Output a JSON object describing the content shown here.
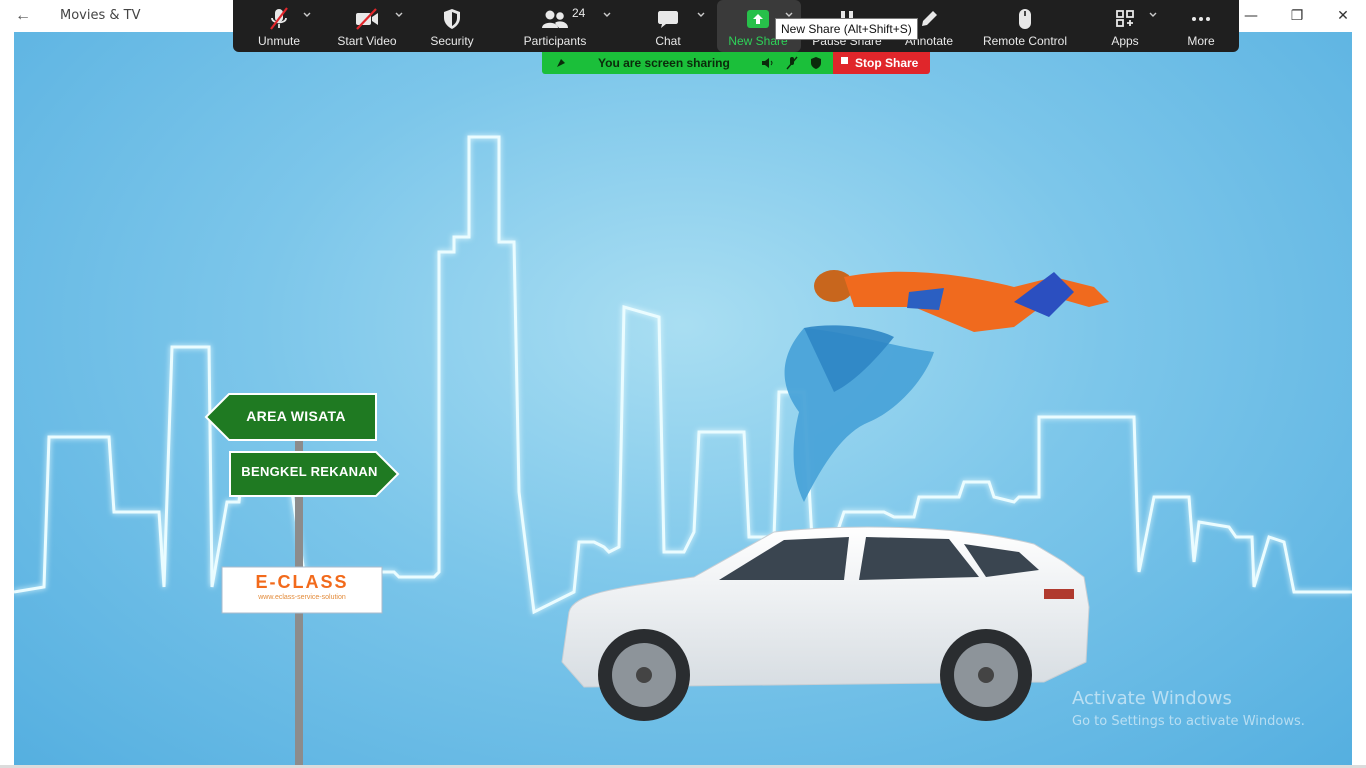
{
  "window": {
    "app_title": "Movies & TV",
    "back_icon": "arrow-left-icon",
    "controls": [
      "minimize-icon",
      "restore-icon",
      "close-icon"
    ]
  },
  "toolbar": {
    "unmute": "Unmute",
    "start_video": "Start Video",
    "security": "Security",
    "participants": "Participants",
    "participants_count": "24",
    "chat": "Chat",
    "new_share": "New Share",
    "pause_share": "Pause Share",
    "annotate": "Annotate",
    "remote_control": "Remote Control",
    "apps": "Apps",
    "more": "More",
    "tooltip": "New Share (Alt+Shift+S)"
  },
  "share_status": {
    "text": "You are screen sharing",
    "stop_label": "Stop Share",
    "colors": {
      "bar": "#1bbf3a",
      "stop": "#e0262b"
    }
  },
  "scene": {
    "sign_1": "AREA WISATA",
    "sign_2": "BENGKEL REKANAN",
    "logo_text": "E-CLASS",
    "logo_subtext": "www.eclass-service-solution"
  },
  "watermark": {
    "title": "Activate Windows",
    "subtitle": "Go to Settings to activate Windows."
  }
}
